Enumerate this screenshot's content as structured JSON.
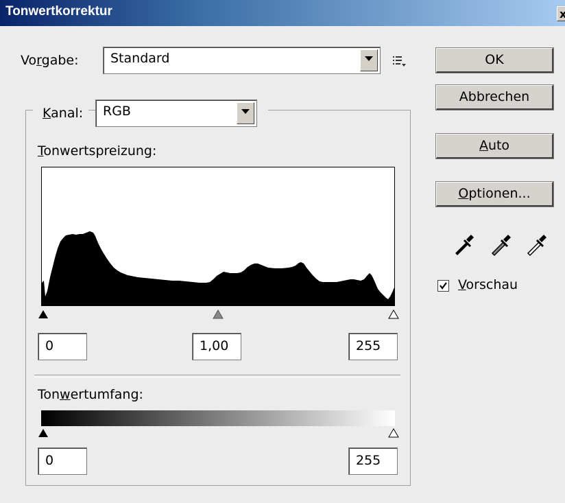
{
  "dialog": {
    "title": "Tonwertkorrektur",
    "close_label": "x"
  },
  "preset": {
    "label_pre": "Vo",
    "label_u": "r",
    "label_post": "gabe:",
    "value": "Standard"
  },
  "buttons": {
    "ok": "OK",
    "cancel": "Abbrechen",
    "auto_u": "A",
    "auto_post": "uto",
    "options_u": "O",
    "options_post": "ptionen..."
  },
  "channel": {
    "label_u": "K",
    "label_post": "anal:",
    "value": "RGB"
  },
  "input_levels": {
    "label_u": "T",
    "label_post": "onwertspreizung:",
    "black": "0",
    "gamma": "1,00",
    "white": "255"
  },
  "output_levels": {
    "label_pre": "Ton",
    "label_u": "w",
    "label_post": "ertumfang:",
    "black": "0",
    "white": "255"
  },
  "preview": {
    "label_u": "V",
    "label_post": "orschau",
    "checked": true
  },
  "icons": [
    "options-menu-icon",
    "black-point-eyedropper-icon",
    "gray-point-eyedropper-icon",
    "white-point-eyedropper-icon",
    "check-mark-icon"
  ]
}
